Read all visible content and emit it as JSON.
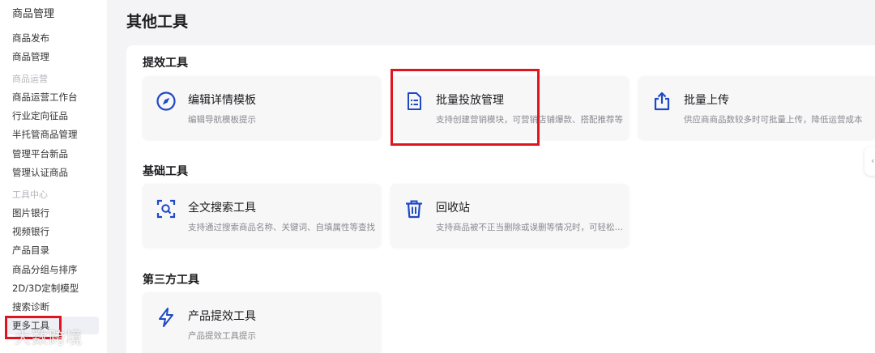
{
  "sidebar": {
    "header": "商品管理",
    "items_top": [
      "商品发布",
      "商品管理"
    ],
    "group_ops": "商品运营",
    "items_ops": [
      "商品运营工作台",
      "行业定向征品",
      "半托管商品管理",
      "管理平台新品",
      "管理认证商品"
    ],
    "group_tools": "工具中心",
    "items_tools": [
      "图片银行",
      "视频银行",
      "产品目录",
      "商品分组与排序",
      "2D/3D定制模型",
      "搜索诊断",
      "更多工具"
    ],
    "active_item": "更多工具"
  },
  "page": {
    "title": "其他工具"
  },
  "sections": [
    {
      "title": "提效工具",
      "cards": [
        {
          "name": "编辑详情模板",
          "desc": "编辑导航模板提示",
          "icon": "compass-icon"
        },
        {
          "name": "批量投放管理",
          "desc": "支持创建营销模块，可营销店铺爆款、搭配推荐等",
          "icon": "document-list-icon"
        },
        {
          "name": "批量上传",
          "desc": "供应商商品数较多时可批量上传，降低运营成本",
          "icon": "upload-icon"
        }
      ]
    },
    {
      "title": "基础工具",
      "cards": [
        {
          "name": "全文搜索工具",
          "desc": "支持通过搜索商品名称、关键词、自填属性等查找",
          "icon": "scan-search-icon"
        },
        {
          "name": "回收站",
          "desc": "支持商品被不正当删除或误删等情况时，可轻松找回",
          "icon": "trash-icon"
        }
      ]
    },
    {
      "title": "第三方工具",
      "cards": [
        {
          "name": "产品提效工具",
          "desc": "产品提效工具提示",
          "icon": "lightning-icon"
        }
      ]
    }
  ],
  "edge_tab_glyph": "‹",
  "watermark": "大数跨境",
  "colors": {
    "accent": "#1f48c4",
    "highlight": "#e0141e"
  }
}
